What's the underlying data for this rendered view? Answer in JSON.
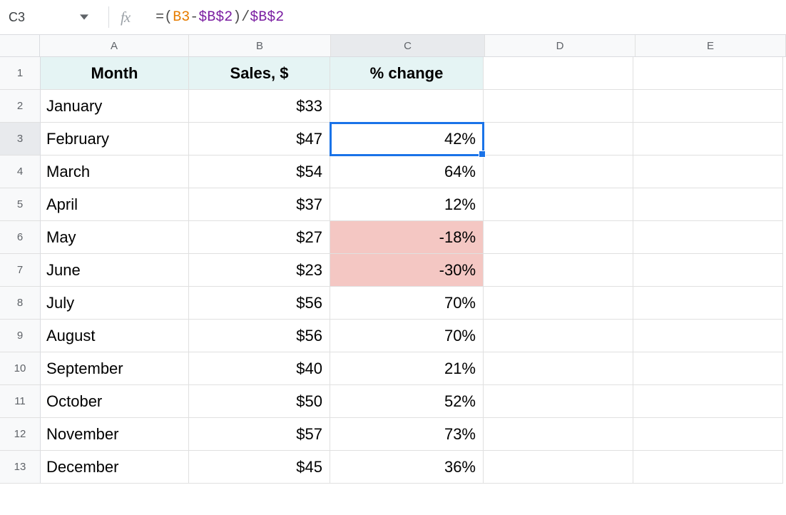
{
  "nameBox": {
    "value": "C3"
  },
  "fxLabel": "fx",
  "formula": {
    "parts": [
      {
        "text": "=",
        "color": "#4d4d4d"
      },
      {
        "text": "(",
        "color": "#4d4d4d"
      },
      {
        "text": "B3",
        "color": "#E67C00"
      },
      {
        "text": "-",
        "color": "#4d4d4d"
      },
      {
        "text": "$B$2",
        "color": "#7B1FA2"
      },
      {
        "text": ")",
        "color": "#4d4d4d"
      },
      {
        "text": "/",
        "color": "#4d4d4d"
      },
      {
        "text": "$B$2",
        "color": "#7B1FA2"
      }
    ]
  },
  "columns": [
    "A",
    "B",
    "C",
    "D",
    "E"
  ],
  "selectedColumn": "C",
  "selectedRow": 3,
  "headers": {
    "A": "Month",
    "B": "Sales, $",
    "C": "% change"
  },
  "rows": [
    {
      "n": 1
    },
    {
      "n": 2,
      "month": "January",
      "sales": "$33",
      "change": ""
    },
    {
      "n": 3,
      "month": "February",
      "sales": "$47",
      "change": "42%"
    },
    {
      "n": 4,
      "month": "March",
      "sales": "$54",
      "change": "64%"
    },
    {
      "n": 5,
      "month": "April",
      "sales": "$37",
      "change": "12%"
    },
    {
      "n": 6,
      "month": "May",
      "sales": "$27",
      "change": "-18%",
      "neg": true
    },
    {
      "n": 7,
      "month": "June",
      "sales": "$23",
      "change": "-30%",
      "neg": true
    },
    {
      "n": 8,
      "month": "July",
      "sales": "$56",
      "change": "70%"
    },
    {
      "n": 9,
      "month": "August",
      "sales": "$56",
      "change": "70%"
    },
    {
      "n": 10,
      "month": "September",
      "sales": "$40",
      "change": "21%"
    },
    {
      "n": 11,
      "month": "October",
      "sales": "$50",
      "change": "52%"
    },
    {
      "n": 12,
      "month": "November",
      "sales": "$57",
      "change": "73%"
    },
    {
      "n": 13,
      "month": "December",
      "sales": "$45",
      "change": "36%"
    }
  ],
  "chart_data": {
    "type": "table",
    "title": "",
    "columns": [
      "Month",
      "Sales, $",
      "% change"
    ],
    "rows": [
      [
        "January",
        33,
        null
      ],
      [
        "February",
        47,
        0.42
      ],
      [
        "March",
        54,
        0.64
      ],
      [
        "April",
        37,
        0.12
      ],
      [
        "May",
        27,
        -0.18
      ],
      [
        "June",
        23,
        -0.3
      ],
      [
        "July",
        56,
        0.7
      ],
      [
        "August",
        56,
        0.7
      ],
      [
        "September",
        40,
        0.21
      ],
      [
        "October",
        50,
        0.52
      ],
      [
        "November",
        57,
        0.73
      ],
      [
        "December",
        45,
        0.36
      ]
    ]
  }
}
